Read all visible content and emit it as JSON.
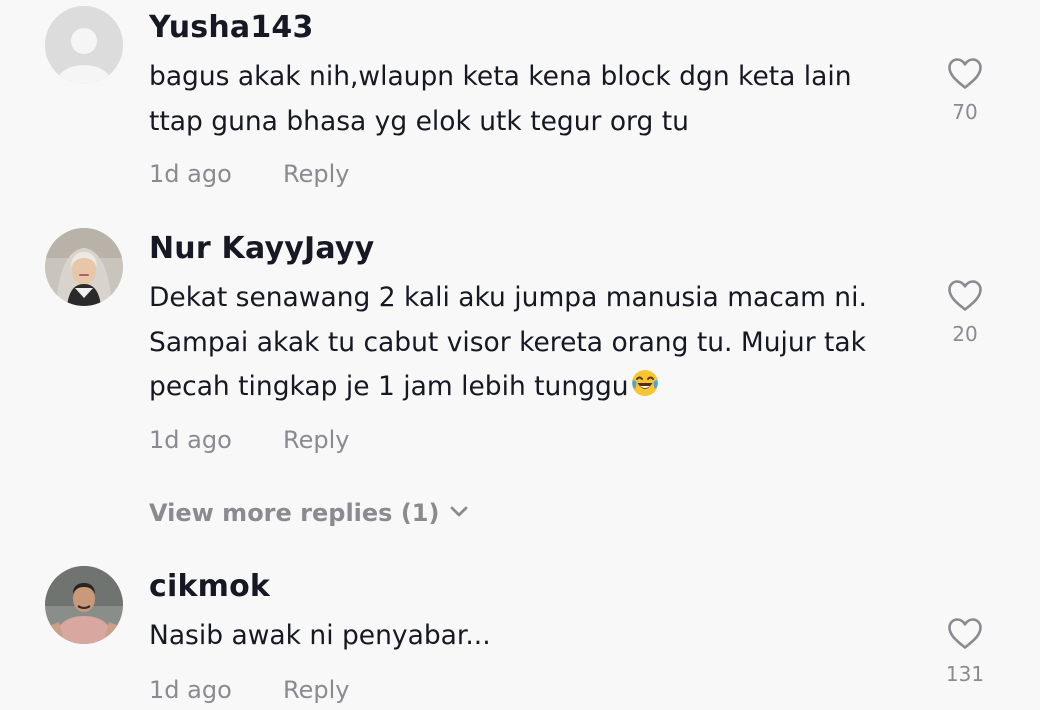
{
  "comments": [
    {
      "username": "Yusha143",
      "text": "bagus akak nih,wlaupn keta kena block dgn keta lain ttap guna bhasa yg elok utk tegur org tu",
      "time": "1d ago",
      "reply_label": "Reply",
      "likes": "70",
      "avatar": "default-avatar-icon"
    },
    {
      "username": "Nur KayyJayy",
      "text": "Dekat senawang 2 kali aku jumpa manusia macam ni. Sampai akak tu cabut visor kereta orang tu. Mujur tak pecah tingkap je 1 jam lebih tunggu",
      "emoji": "face-with-tears-of-joy",
      "time": "1d ago",
      "reply_label": "Reply",
      "likes": "20",
      "avatar": "hijab-woman-photo"
    },
    {
      "username": "cikmok",
      "text": "Nasib awak ni penyabar...",
      "time": "1d ago",
      "reply_label": "Reply",
      "likes": "131",
      "avatar": "man-pink-shirt-photo"
    }
  ],
  "view_more_replies": "View more replies (1)",
  "colors": {
    "background": "#f8f8f8",
    "primary_text": "#161823",
    "secondary_text": "#8a8b91",
    "avatar_placeholder": "#d9d9d9"
  }
}
